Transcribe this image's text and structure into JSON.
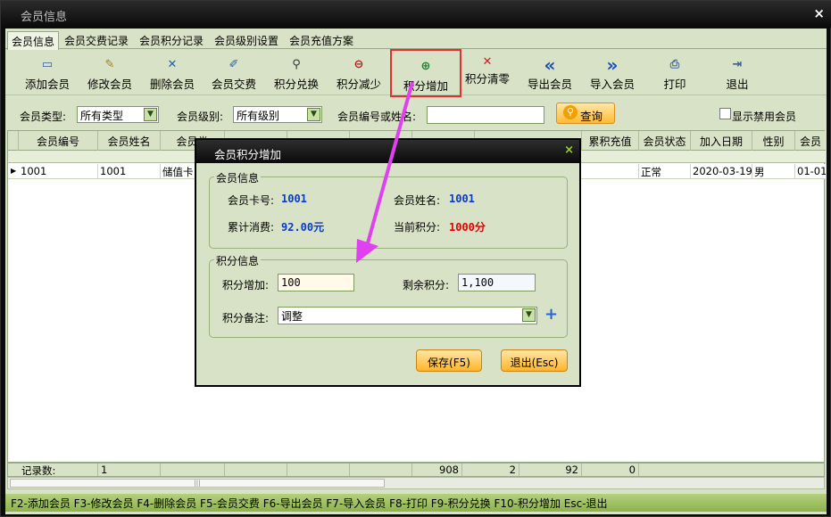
{
  "window": {
    "title": "会员信息",
    "close_glyph": "×"
  },
  "tabs": [
    "会员信息",
    "会员交费记录",
    "会员积分记录",
    "会员级别设置",
    "会员充值方案"
  ],
  "toolbar": [
    {
      "label": "添加会员",
      "icon": "new-page-icon",
      "glyph": "🗋",
      "color": "#3b5a9a"
    },
    {
      "label": "修改会员",
      "icon": "edit-clipboard-icon",
      "glyph": "✎",
      "color": "#b07a1a"
    },
    {
      "label": "删除会员",
      "icon": "delete-x-icon",
      "glyph": "✕",
      "color": "#2a5db0"
    },
    {
      "label": "会员交费",
      "icon": "pen-icon",
      "glyph": "✐",
      "color": "#2a5db0"
    },
    {
      "label": "积分兑换",
      "icon": "magnifier-icon",
      "glyph": "⚲",
      "color": "#333"
    },
    {
      "label": "积分减少",
      "icon": "zoom-out-icon",
      "glyph": "⊖",
      "color": "#b02020"
    },
    {
      "label": "积分增加",
      "icon": "zoom-in-icon",
      "glyph": "⊕",
      "color": "#208030"
    },
    {
      "label": "积分清零",
      "icon": "clear-x-icon",
      "glyph": "✕",
      "color": "#d02020"
    },
    {
      "label": "导出会员",
      "icon": "double-left-arrow-icon",
      "glyph": "«",
      "color": "#1a4fb4"
    },
    {
      "label": "导入会员",
      "icon": "double-right-arrow-icon",
      "glyph": "»",
      "color": "#1a4fb4"
    },
    {
      "label": "打印",
      "icon": "printer-icon",
      "glyph": "⎙",
      "color": "#4a6a9a"
    },
    {
      "label": "退出",
      "icon": "exit-door-icon",
      "glyph": "⇥",
      "color": "#3a5fa0"
    }
  ],
  "filter": {
    "type_label": "会员类型:",
    "type_value": "所有类型",
    "level_label": "会员级别:",
    "level_value": "所有级别",
    "search_label": "会员编号或姓名:",
    "search_value": "",
    "search_button": "查询",
    "show_disabled": "显示禁用会员"
  },
  "grid": {
    "columns": [
      "会员编号",
      "会员姓名",
      "会员类",
      "",
      "",
      "",
      "",
      "",
      "累积充值",
      "会员状态",
      "加入日期",
      "性别",
      "会员"
    ],
    "row": [
      "1001",
      "1001",
      "储值卡",
      "",
      "",
      "",
      "",
      "",
      "",
      "正常",
      "2020-03-19",
      "男",
      "01-01"
    ],
    "row_marker": "▶"
  },
  "footer": {
    "label": "记录数:",
    "cells": [
      "1",
      "",
      "",
      "",
      "",
      "908",
      "2",
      "92",
      "0",
      ""
    ]
  },
  "statusbar": "F2-添加会员 F3-修改会员 F4-删除会员 F5-会员交费 F6-导出会员 F7-导入会员 F8-打印 F9-积分兑换 F10-积分增加 Esc-退出",
  "dialog": {
    "title": "会员积分增加",
    "close_glyph": "×",
    "member_group": "会员信息",
    "card_label": "会员卡号:",
    "card_value": "1001",
    "name_label": "会员姓名:",
    "name_value": "1001",
    "spent_label": "累计消费:",
    "spent_value": "92.00元",
    "points_label": "当前积分:",
    "points_value": "1000分",
    "points_group": "积分信息",
    "add_label": "积分增加:",
    "add_value": "100",
    "remain_label": "剩余积分:",
    "remain_value": "1,100",
    "note_label": "积分备注:",
    "note_value": "调整",
    "save_button": "保存(F5)",
    "exit_button": "退出(Esc)"
  },
  "colors": {
    "blue_value": "#0a3ac8",
    "red_value": "#e00000",
    "annotation": "#e040f0",
    "highlight_box": "#e23030"
  }
}
